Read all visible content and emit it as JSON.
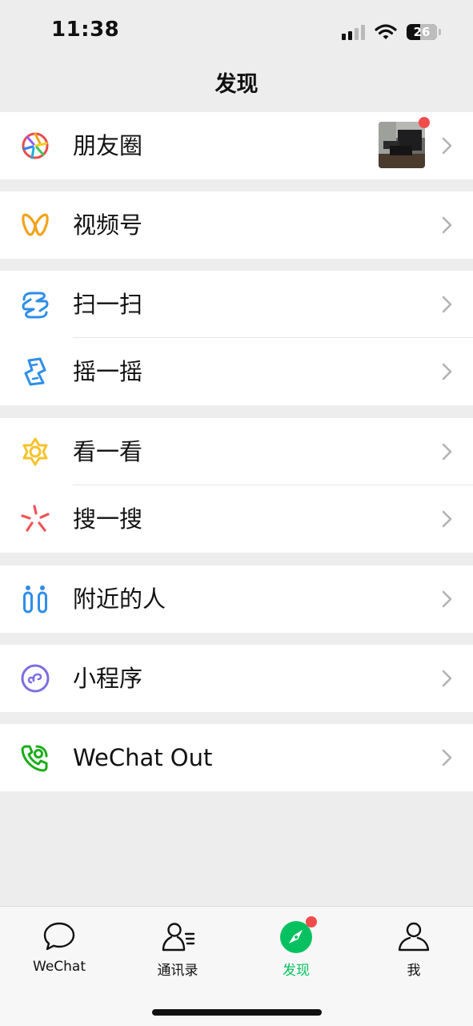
{
  "status_bar": {
    "time": "11:38",
    "battery": "26"
  },
  "nav": {
    "title": "发现"
  },
  "moments": {
    "label": "朋友圈"
  },
  "channels": {
    "label": "视频号"
  },
  "scan": {
    "label": "扫一扫"
  },
  "shake": {
    "label": "摇一摇"
  },
  "top_stories": {
    "label": "看一看"
  },
  "search": {
    "label": "搜一搜"
  },
  "nearby": {
    "label": "附近的人"
  },
  "mini_programs": {
    "label": "小程序"
  },
  "wechat_out": {
    "label": "WeChat Out"
  },
  "tab_bar": {
    "tabs": [
      {
        "label": "WeChat",
        "icon": "chat-bubble-icon"
      },
      {
        "label": "通讯录",
        "icon": "contacts-icon"
      },
      {
        "label": "发现",
        "icon": "compass-icon",
        "active": true,
        "badge": "dot"
      },
      {
        "label": "我",
        "icon": "person-icon"
      }
    ]
  },
  "colors": {
    "accent_green": "#07c160",
    "badge_red": "#f14c4c",
    "background": "#ededed"
  }
}
